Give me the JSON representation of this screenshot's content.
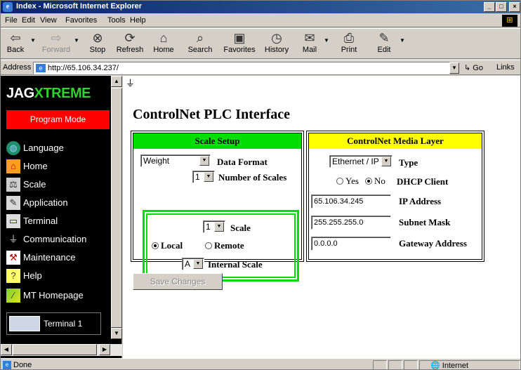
{
  "window": {
    "title": "Index - Microsoft Internet Explorer"
  },
  "menu": [
    {
      "label": "File"
    },
    {
      "label": "Edit"
    },
    {
      "label": "View"
    },
    {
      "label": "Favorites"
    },
    {
      "label": "Tools"
    },
    {
      "label": "Help"
    }
  ],
  "toolbar": {
    "back": "Back",
    "forward": "Forward",
    "stop": "Stop",
    "refresh": "Refresh",
    "home": "Home",
    "search": "Search",
    "favorites": "Favorites",
    "history": "History",
    "mail": "Mail",
    "print": "Print",
    "edit": "Edit"
  },
  "address": {
    "label": "Address",
    "url": "http://65.106.34.237/",
    "go": "Go",
    "links": "Links"
  },
  "sidebar": {
    "brand_a": "JAG",
    "brand_b": "XTREME",
    "mode": "Program Mode",
    "items": [
      {
        "label": "Language",
        "icon": "globe-icon"
      },
      {
        "label": "Home",
        "icon": "house-icon"
      },
      {
        "label": "Scale",
        "icon": "scale-icon"
      },
      {
        "label": "Application",
        "icon": "wrench-icon"
      },
      {
        "label": "Terminal",
        "icon": "terminal-icon"
      },
      {
        "label": "Communication",
        "icon": "plug-icon"
      },
      {
        "label": "Maintenance",
        "icon": "tools-icon"
      },
      {
        "label": "Help",
        "icon": "question-icon"
      },
      {
        "label": "MT Homepage",
        "icon": "web-icon"
      }
    ],
    "terminal1": "Terminal 1"
  },
  "main": {
    "title": "ControlNet PLC Interface",
    "scale_setup": {
      "heading": "Scale Setup",
      "data_format_value": "Weight",
      "data_format_label": "Data Format",
      "num_scales_value": "1",
      "num_scales_label": "Number of Scales",
      "scale_value": "1",
      "scale_label": "Scale",
      "local_label": "Local",
      "remote_label": "Remote",
      "internal_value": "A",
      "internal_label": "Internal Scale"
    },
    "media_layer": {
      "heading": "ControlNet Media Layer",
      "type_value": "Ethernet / IP",
      "type_label": "Type",
      "yes_label": "Yes",
      "no_label": "No",
      "dhcp_label": "DHCP Client",
      "ip_value": "65.106.34.245",
      "ip_label": "IP Address",
      "mask_value": "255.255.255.0",
      "mask_label": "Subnet Mask",
      "gateway_value": "0.0.0.0",
      "gateway_label": "Gateway Address"
    },
    "save_button": "Save Changes"
  },
  "status": {
    "text": "Done",
    "zone": "Internet"
  },
  "colors": {
    "scale_header": "#00dd00",
    "media_header": "#ffff00",
    "mode_badge": "#ff0000",
    "brand_accent": "#2ed12e"
  }
}
